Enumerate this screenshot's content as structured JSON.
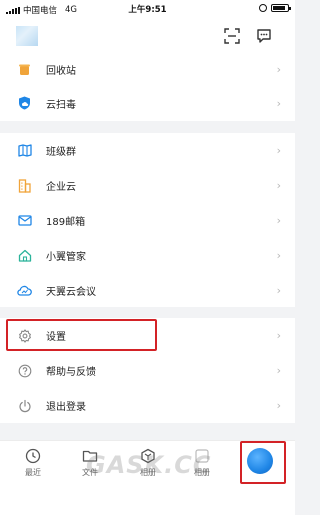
{
  "status_bar": {
    "carrier": "中国电信",
    "network": "4G",
    "time": "上午9:51"
  },
  "header": {
    "scan_icon": "scan-icon",
    "message_icon": "message-icon"
  },
  "menu_group_1": [
    {
      "label": "回收站",
      "icon": "recycle-bin-icon"
    },
    {
      "label": "云扫毒",
      "icon": "cloud-antivirus-icon"
    }
  ],
  "menu_group_2": [
    {
      "label": "班级群",
      "icon": "class-group-icon"
    },
    {
      "label": "企业云",
      "icon": "enterprise-cloud-icon"
    },
    {
      "label": "189邮箱",
      "icon": "mail-icon"
    },
    {
      "label": "小翼管家",
      "icon": "home-manager-icon"
    },
    {
      "label": "天翼云会议",
      "icon": "cloud-meeting-icon"
    }
  ],
  "menu_group_3": [
    {
      "label": "设置",
      "icon": "settings-gear-icon"
    },
    {
      "label": "帮助与反馈",
      "icon": "help-icon"
    },
    {
      "label": "退出登录",
      "icon": "power-icon"
    }
  ],
  "bottom_nav": [
    {
      "label": "最近",
      "icon": "clock-icon"
    },
    {
      "label": "文件",
      "icon": "folder-icon"
    },
    {
      "label": "相册",
      "icon": "photo-icon"
    },
    {
      "label": "相册",
      "icon": "album-icon"
    }
  ],
  "watermark": "GASK.CC",
  "colors": {
    "accent_blue": "#1f86e6",
    "highlight_red": "#d32226",
    "background": "#f2f3f5"
  }
}
